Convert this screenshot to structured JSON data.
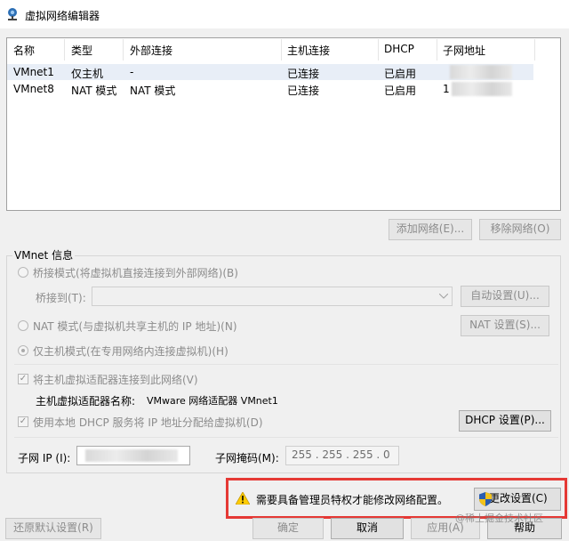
{
  "window": {
    "title": "虚拟网络编辑器",
    "icon": "network-editor-icon"
  },
  "table": {
    "headers": [
      "名称",
      "类型",
      "外部连接",
      "主机连接",
      "DHCP",
      "子网地址"
    ],
    "rows": [
      {
        "name": "VMnet1",
        "type": "仅主机",
        "external": "-",
        "host": "已连接",
        "dhcp": "已启用",
        "subnet": ""
      },
      {
        "name": "VMnet8",
        "type": "NAT 模式",
        "external": "NAT 模式",
        "host": "已连接",
        "dhcp": "已启用",
        "subnet": "1"
      }
    ]
  },
  "buttons": {
    "add_network": "添加网络(E)...",
    "remove_network": "移除网络(O)",
    "auto_settings": "自动设置(U)...",
    "nat_settings": "NAT 设置(S)...",
    "dhcp_settings": "DHCP 设置(P)...",
    "change_settings": "更改设置(C)",
    "restore_defaults": "还原默认设置(R)",
    "ok": "确定",
    "cancel": "取消",
    "apply": "应用(A)",
    "help": "帮助"
  },
  "vmnet_info": {
    "group_title": "VMnet 信息",
    "bridged_mode": "桥接模式(将虚拟机直接连接到外部网络)(B)",
    "bridge_to_label": "桥接到(T):",
    "nat_mode": "NAT 模式(与虚拟机共享主机的 IP 地址)(N)",
    "host_only_mode": "仅主机模式(在专用网络内连接虚拟机)(H)",
    "connect_adapter": "将主机虚拟适配器连接到此网络(V)",
    "adapter_name_label": "主机虚拟适配器名称:",
    "adapter_name_value": "VMware 网络适配器 VMnet1",
    "use_dhcp": "使用本地 DHCP 服务将 IP 地址分配给虚拟机(D)",
    "subnet_ip_label": "子网 IP (I):",
    "subnet_mask_label": "子网掩码(M):",
    "subnet_mask_value": "255 . 255 . 255 . 0",
    "selected_mode": "host-only",
    "connect_adapter_checked": true,
    "use_dhcp_checked": true
  },
  "warning": {
    "text": "需要具备管理员特权才能修改网络配置。",
    "icon": "warning-icon"
  },
  "watermark": "@稀土掘金技术社区",
  "colors": {
    "warning_border": "#e53935",
    "selection_row": "#e8eef7"
  }
}
